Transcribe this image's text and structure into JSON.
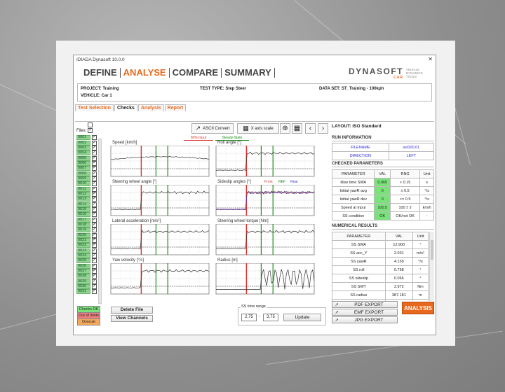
{
  "window": {
    "title": "IDIADA Dynasoft 10.0.0",
    "close": "✕"
  },
  "menu": [
    "DEFINE",
    "ANALYSE",
    "COMPARE",
    "SUMMARY"
  ],
  "logo": {
    "main": "DYNASOFT",
    "sub": "CAR",
    "tag": "VEHICLE DYNAMICS TOOLS"
  },
  "info": {
    "project": "PROJECT: Training",
    "vehicle": "VEHICLE: Car 1",
    "test_type": "TEST TYPE: Step Steer",
    "data_set": "DATA SET: ST_Training - 100kph"
  },
  "tabs": [
    "Test Selection",
    "Checks",
    "Analysis",
    "Report"
  ],
  "files": {
    "label": "Files:",
    "ids": [
      "0001",
      "0002",
      "0003",
      "0004",
      "0005",
      "0006",
      "0007",
      "0008",
      "0009",
      "0010",
      "0011",
      "0012",
      "0013",
      "0014",
      "0015",
      "0016",
      "0017",
      "0018",
      "0019",
      "0020",
      "0021",
      "0022",
      "0023",
      "0024",
      "0025",
      "0026",
      "0027",
      "0028",
      "0029",
      "0030",
      "0031"
    ]
  },
  "legend": {
    "ok": "Checks OK",
    "out": "Out of limits",
    "override": "Overule"
  },
  "buttons": {
    "delete": "Delete File",
    "view": "View Channels",
    "ascii": "ASCII Convert",
    "xscale": "X axis scale",
    "update": "Update"
  },
  "markers": {
    "input": "50% Input",
    "steady": "Steady-State"
  },
  "charts": [
    {
      "title": "Speed [km/h]"
    },
    {
      "title": "Roll angle [°]"
    },
    {
      "title": "Steering wheel angle [°]"
    },
    {
      "title": "Sideslip angles [°]"
    },
    {
      "title": "Lateral acceleration [m/s²]"
    },
    {
      "title": "Steering wheel torque [Nm]"
    },
    {
      "title": "Yaw velocity [°/s]"
    },
    {
      "title": "Radius [m]"
    }
  ],
  "sideslip_legend": [
    "Front",
    "REF",
    "Rear"
  ],
  "ss_range": {
    "label": "SS time range",
    "from": "2,75",
    "sep": "-",
    "to": "3,75"
  },
  "layout": "LAYOUT: ISO Standard",
  "run_info": {
    "title": "RUN INFORMATION",
    "rows": [
      {
        "k": "FILENAME",
        "v": "sst100.01"
      },
      {
        "k": "DIRECTION",
        "v": "LEFT"
      }
    ]
  },
  "checked": {
    "title": "CHECKED PARAMETERS",
    "headers": [
      "PARAMETER",
      "VAL",
      "RNG",
      "Unit"
    ],
    "rows": [
      {
        "p": "Rise time SWA",
        "v": "0.065",
        "r": "< 0.15",
        "u": "s"
      },
      {
        "p": "Initial yawR avg",
        "v": "0",
        "r": "± 0.5",
        "u": "°/s"
      },
      {
        "p": "Initial yawR dev",
        "v": "0",
        "r": "<= 0.5",
        "u": "°/s"
      },
      {
        "p": "Speed at input",
        "v": "100.5",
        "r": "100 ± 2",
        "u": "km/h"
      },
      {
        "p": "SS condition",
        "v": "OK",
        "r": "OK/not OK",
        "u": "-"
      }
    ]
  },
  "numerical": {
    "title": "NUMERICAL RESULTS",
    "headers": [
      "PARAMETER",
      "VAL",
      "Unit"
    ],
    "rows": [
      {
        "p": "SS SWA",
        "v": "12.900",
        "u": "°"
      },
      {
        "p": "SS acc_Y",
        "v": "2.031",
        "u": "m/s²"
      },
      {
        "p": "SS yawR",
        "v": "4.159",
        "u": "°/s"
      },
      {
        "p": "SS roll",
        "v": "0.758",
        "u": "°"
      },
      {
        "p": "SS sideslip",
        "v": "0.066",
        "u": "°"
      },
      {
        "p": "SS SWT",
        "v": "2.972",
        "u": "Nm"
      },
      {
        "p": "SS radius",
        "v": "387.181",
        "u": "m"
      },
      {
        "p": "yawR/SWA gain",
        "v": "0.322",
        "u": "1/s"
      }
    ]
  },
  "exports": [
    "PDF EXPORT",
    "EMF EXPORT",
    "JPG EXPORT"
  ],
  "analysis_button": "ANALYSIS",
  "colors": {
    "accent": "#e8691e",
    "ok": "#7be27b",
    "out": "#f08080",
    "marker_red": "#e03030",
    "marker_green": "#1a8a1a"
  }
}
